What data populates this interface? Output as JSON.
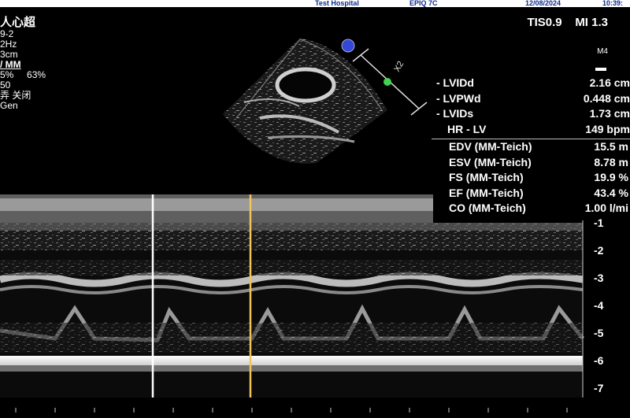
{
  "header": {
    "hospital": "Test Hospital",
    "device": "EPIQ 7C",
    "date": "12/08/2024",
    "time": "10:39:"
  },
  "left_panel": {
    "title": "人心超",
    "probe_freq": "9-2",
    "hz": "2Hz",
    "depth": "3cm",
    "mode": "/ MM",
    "gain_left": "5%",
    "gain_right": "63%",
    "value": "50",
    "preset": "弄 关闭",
    "gen": "Gen"
  },
  "status": {
    "tis": "TIS0.9",
    "mi": "MI 1.3",
    "probe_label": "M4"
  },
  "measurements": [
    {
      "label": "- LVIDd",
      "value": "2.16 cm"
    },
    {
      "label": "- LVPWd",
      "value": "0.448 cm"
    },
    {
      "label": "- LVIDs",
      "value": "1.73 cm"
    },
    {
      "label": "HR - LV",
      "value": "149 bpm"
    }
  ],
  "calculations": [
    {
      "label": "EDV (MM-Teich)",
      "value": "15.5 m"
    },
    {
      "label": "ESV (MM-Teich)",
      "value": "8.78 m"
    },
    {
      "label": "FS (MM-Teich)",
      "value": "19.9 %"
    },
    {
      "label": "EF (MM-Teich)",
      "value": "43.4 %"
    },
    {
      "label": "CO (MM-Teich)",
      "value": "1.00 l/mi"
    }
  ],
  "depth_ticks": [
    "-1",
    "-2",
    "-3",
    "-4",
    "-5",
    "-6",
    "-7"
  ],
  "mline_label": "X2",
  "colors": {
    "header_text": "#0a2a8a",
    "measure_text": "#ffffff",
    "cursor_white": "#ffffff",
    "cursor_yellow": "#f2c45a",
    "mline_green": "#44d050"
  }
}
